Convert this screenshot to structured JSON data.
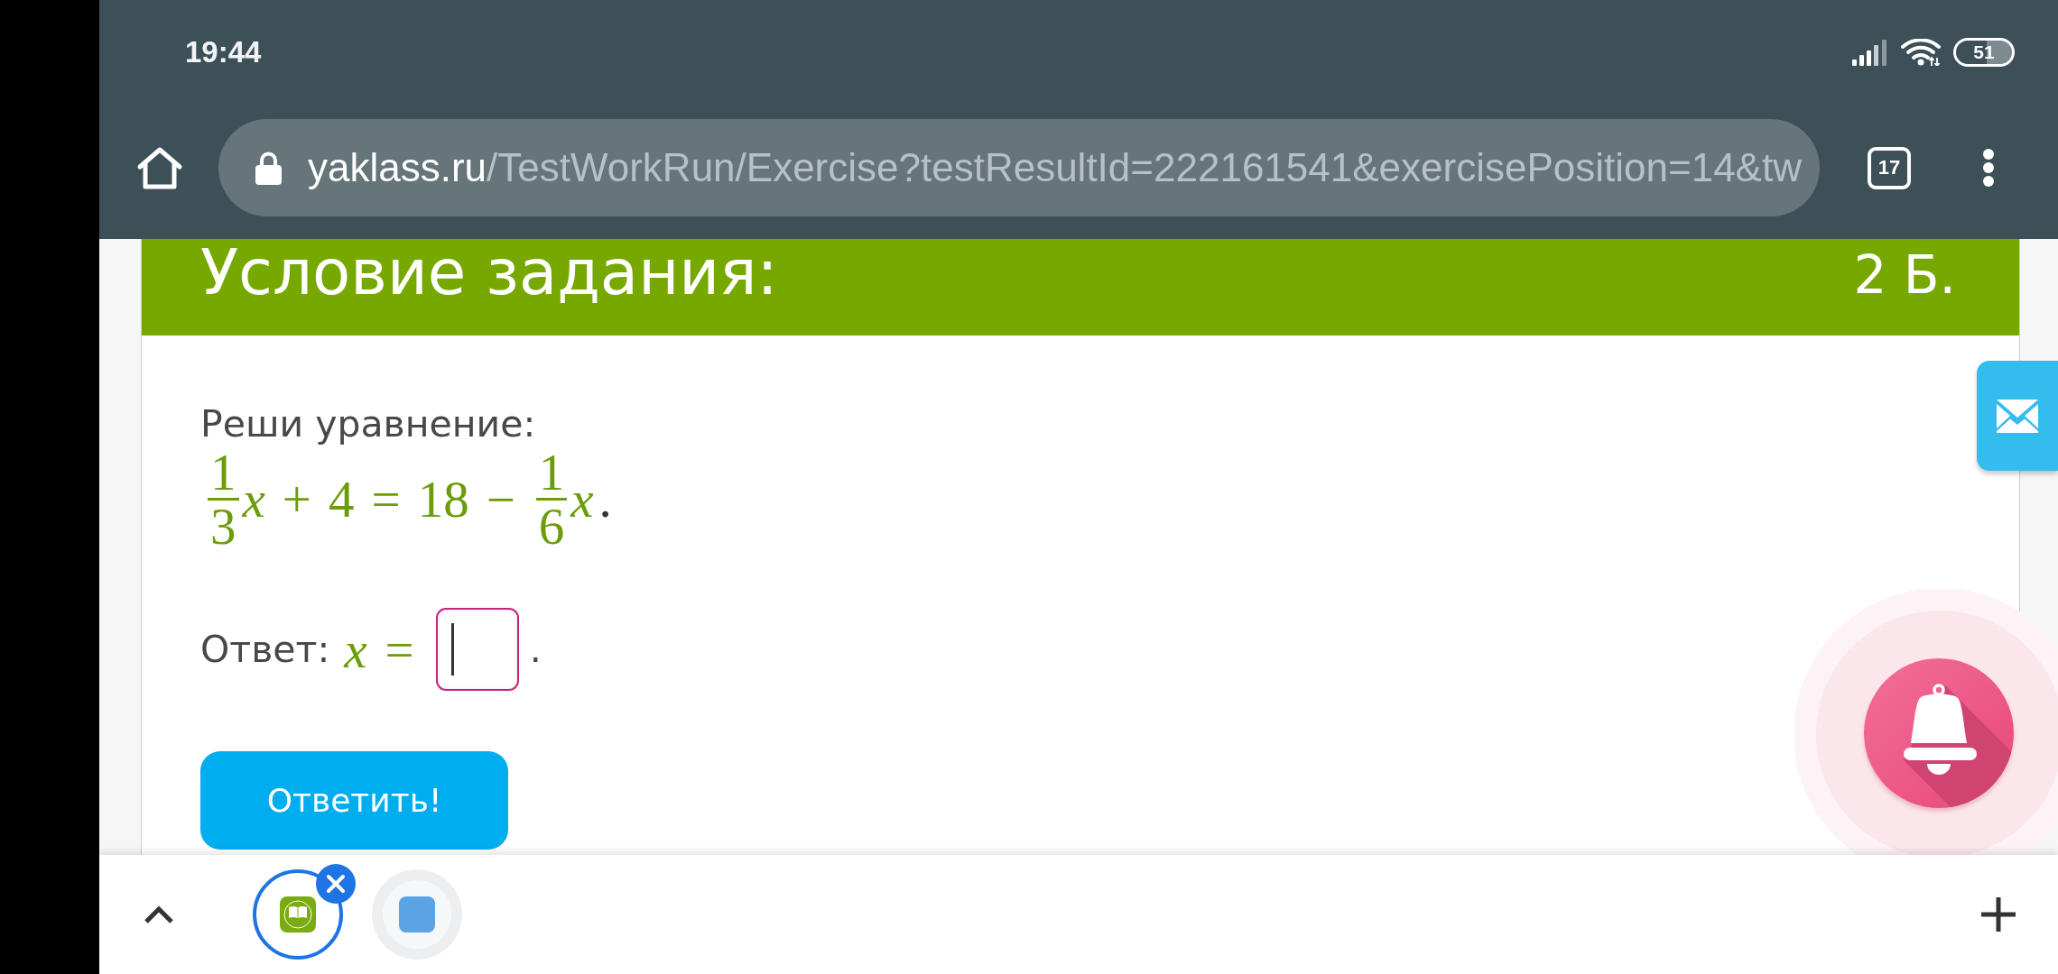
{
  "status_bar": {
    "time": "19:44",
    "battery": "51"
  },
  "browser": {
    "url_host": "yaklass.ru",
    "url_path": "/TestWorkRun/Exercise?testResultId=222161541&exercisePosition=14&tw",
    "tab_count": "17"
  },
  "task": {
    "title": "Условие задания:",
    "points": "2 Б.",
    "prompt": "Реши уравнение:",
    "equation": [
      {
        "kind": "frac",
        "num": "1",
        "den": "3"
      },
      {
        "kind": "var",
        "text": "x"
      },
      {
        "kind": "op",
        "text": "+"
      },
      {
        "kind": "num",
        "text": "4"
      },
      {
        "kind": "op",
        "text": "="
      },
      {
        "kind": "num",
        "text": "18"
      },
      {
        "kind": "op",
        "text": "−"
      },
      {
        "kind": "frac",
        "num": "1",
        "den": "6"
      },
      {
        "kind": "var",
        "text": "x"
      },
      {
        "kind": "punct",
        "text": "."
      }
    ],
    "answer": {
      "label": "Ответ:",
      "lhs": [
        {
          "kind": "var",
          "text": "x"
        },
        {
          "kind": "op",
          "text": "="
        }
      ],
      "field": {
        "focused": true
      },
      "end": "."
    },
    "submit_button": "Ответить!"
  },
  "tab_strip": {
    "tabs": [
      {
        "kind": "book",
        "color": "#7aab10",
        "selected": true
      },
      {
        "kind": "plain",
        "color": "#5aa3e4",
        "selected": false
      }
    ]
  }
}
